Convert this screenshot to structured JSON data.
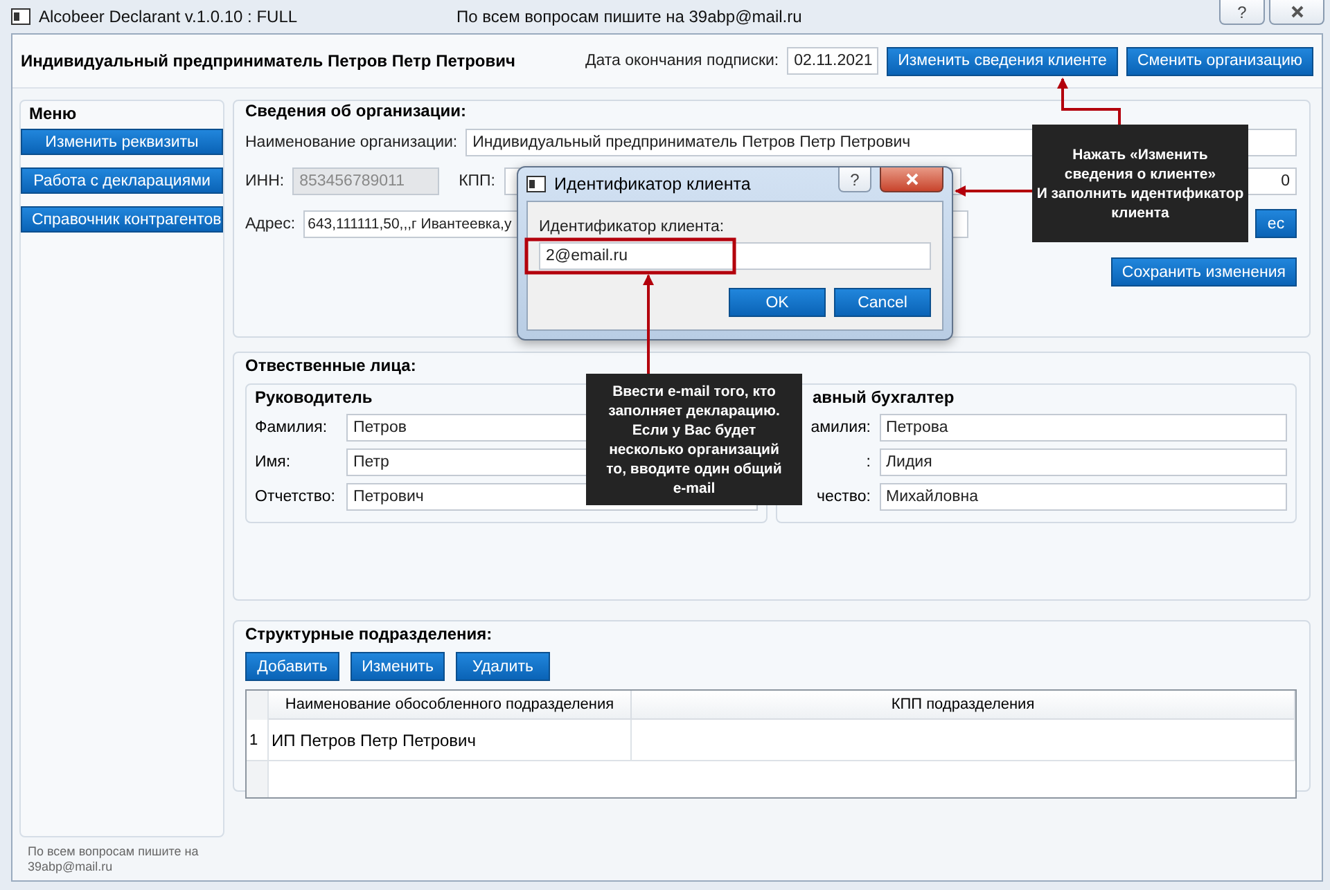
{
  "window": {
    "title": "Alcobeer Declarant v.1.0.10 : FULL",
    "notice": "По всем вопросам пишите на 39abp@mail.ru",
    "help_button": "?"
  },
  "header": {
    "organization": "Индивидуальный предприниматель Петров Петр Петрович",
    "subscription_label": "Дата окончания подписки:",
    "subscription_date": "02.11.2021",
    "buttons": [
      "Изменить сведения клиенте",
      "Сменить организацию"
    ]
  },
  "menu": {
    "title": "Меню",
    "items": [
      "Изменить реквизиты",
      "Работа с декларациями",
      "Справочник контрагентов"
    ],
    "footer": "По всем вопросам пишите на 39abp@mail.ru"
  },
  "organization": {
    "title": "Сведения об организации:",
    "name_label": "Наименование организации:",
    "name": "Индивидуальный предприниматель Петров Петр Петрович",
    "inn_label": "ИНН:",
    "inn": "853456789011",
    "inn_disabled": true,
    "kpp_label": "КПП:",
    "field_3": "0",
    "address_label": "Адрес:",
    "address": "643,111111,50,,,г Ивантеевка,у",
    "address_button": "ес",
    "save_button": "Сохранить изменения"
  },
  "responsible": {
    "title": "Отвественные лица:",
    "groups": [
      {
        "title": "Руководитель",
        "fields": [
          {
            "label": "Фамилия:",
            "value": "Петров"
          },
          {
            "label": "Имя:",
            "value": "Петр"
          },
          {
            "label": "Отчетство:",
            "value": "Петрович"
          }
        ]
      },
      {
        "title": "авный бухгалтер",
        "fields": [
          {
            "label": "амилия:",
            "value": "Петрова"
          },
          {
            "label": ":",
            "value": "Лидия"
          },
          {
            "label": "чество:",
            "value": "Михайловна"
          }
        ]
      }
    ]
  },
  "subdivisions": {
    "title": "Структурные подразделения:",
    "buttons": [
      "Добавить",
      "Изменить",
      "Удалить"
    ],
    "columns": [
      "Наименование обособленного подразделения",
      "КПП подразделения"
    ],
    "rows": [
      {
        "number": "1",
        "name": "ИП Петров Петр Петрович"
      }
    ]
  },
  "dialog": {
    "title": "Идентификатор клиента",
    "help_button": "?",
    "field_label": "Идентификатор клиента:",
    "value": "2@email.ru",
    "buttons": [
      "OK",
      "Cancel"
    ]
  },
  "callouts": [
    "Нажать «Изменить\nсведения о клиенте»\nИ заполнить  идентификатор\nклиента",
    "Ввести e-mail того, кто\nзаполняет  декларацию.\nЕсли у Вас будет\nнесколько организаций\nто, вводите один  общий\ne-mail"
  ]
}
